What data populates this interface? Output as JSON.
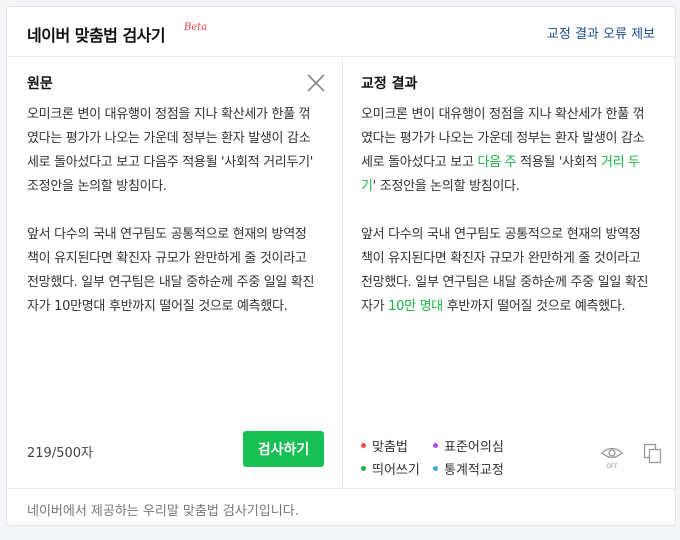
{
  "header": {
    "title": "네이버 맞춤법 검사기",
    "beta": "Beta",
    "report_link": "교정 결과 오류 제보"
  },
  "original": {
    "title": "원문",
    "paragraphs": [
      "오미크론 변이 대유행이 정점을 지나 확산세가 한풀 꺾였다는 평가가 나오는 가운데 정부는 환자 발생이 감소세로 돌아섰다고 보고 다음주 적용될 '사회적 거리두기' 조정안을 논의할 방침이다.",
      "앞서 다수의 국내 연구팀도 공통적으로 현재의 방역정책이 유지된다면 확진자 규모가 완만하게 줄 것이라고 전망했다. 일부 연구팀은 내달 중하순께 주중 일일 확진자가 10만명대 후반까지 떨어질 것으로 예측했다."
    ],
    "char_count": "219/500자",
    "check_button": "검사하기"
  },
  "result": {
    "title": "교정 결과",
    "p1": {
      "before": "오미크론 변이 대유행이 정점을 지나 확산세가 한풀 꺾였다는 평가가 나오는 가운데 정부는 환자 발생이 감소세로 돌아섰다고 보고 ",
      "fix1": "다음 주",
      "middle": " 적용될 '사회적 ",
      "fix2": "거리 두기",
      "after": "' 조정안을 논의할 방침이다."
    },
    "p2": {
      "before": "앞서 다수의 국내 연구팀도 공통적으로 현재의 방역정책이 유지된다면 확진자 규모가 완만하게 줄 것이라고 전망했다. 일부 연구팀은 내달 중하순께 주중 일일 확진자가 ",
      "fix1": "10만 명대",
      "after": " 후반까지 떨어질 것으로 예측했다."
    },
    "legend": [
      {
        "label": "맞춤법",
        "color": "#e84c4c"
      },
      {
        "label": "표준어의심",
        "color": "#b14cf0"
      },
      {
        "label": "띄어쓰기",
        "color": "#17b33f"
      },
      {
        "label": "통계적교정",
        "color": "#3ba9d9"
      }
    ],
    "eye_toggle": "OFF"
  },
  "footer": {
    "text": "네이버에서 제공하는 우리말 맞춤법 검사기입니다."
  },
  "colors": {
    "accent_green": "#17c054",
    "correction_green": "#18b341",
    "link_blue": "#1a4d8f",
    "beta_red": "#e2464a"
  },
  "icons": [
    "close-icon",
    "eye-icon",
    "copy-icon"
  ]
}
